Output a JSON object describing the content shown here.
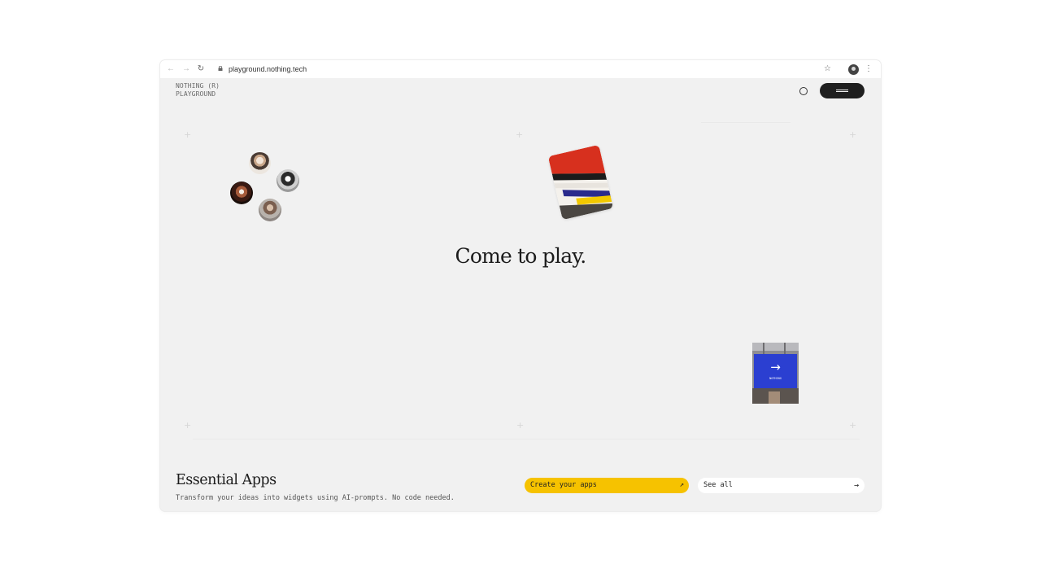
{
  "browser": {
    "back_icon": "←",
    "forward_icon": "→",
    "reload_icon": "↻",
    "url": "playground.nothing.tech",
    "star_icon": "☆",
    "menu_icon": "⋮"
  },
  "header": {
    "logo_line1": "NOTHING (R)",
    "logo_line2": "PLAYGROUND"
  },
  "hero": {
    "title": "Come to play."
  },
  "section": {
    "title": "Essential Apps",
    "subtitle": "Transform your ideas into widgets using AI-prompts. No code needed.",
    "create_label": "Create your apps",
    "create_arrow": "↗",
    "see_all_label": "See all",
    "see_all_arrow": "→"
  },
  "cards": {
    "blue_arrow": "→",
    "blue_caption": "NOTHING"
  },
  "colors": {
    "accent_yellow": "#f6c200",
    "page_bg": "#f1f1f1",
    "dark_button": "#1f1f1f",
    "card_blue": "#2b3fd1",
    "card_red": "#d7301e"
  }
}
